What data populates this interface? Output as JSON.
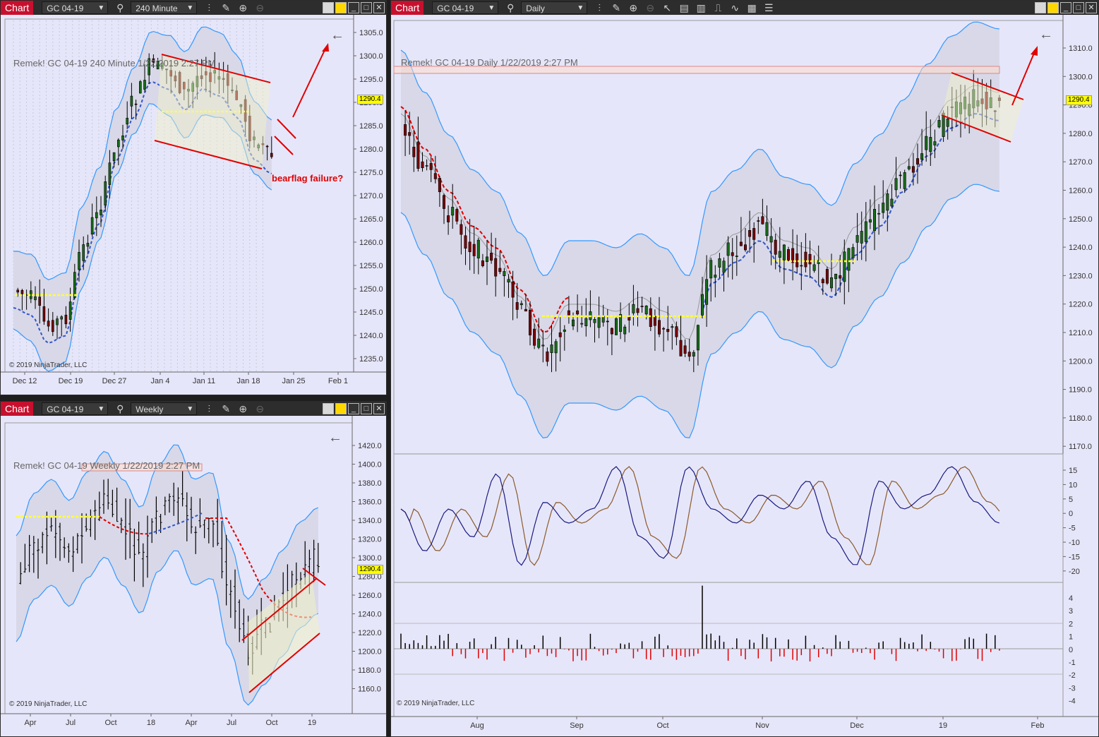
{
  "panels": [
    {
      "id": "p240",
      "tab": "Chart",
      "instrument": "GC 04-19",
      "interval": "240 Minute",
      "title": "Remek!  GC 04-19  240 Minute  1/22/2019 2:27 PM",
      "copyright": "© 2019 NinjaTrader, LLC",
      "price_tag": "1290.4",
      "y_labels": [
        "1305.0",
        "1300.0",
        "1295.0",
        "1290.0",
        "1285.0",
        "1280.0",
        "1275.0",
        "1270.0",
        "1265.0",
        "1260.0",
        "1255.0",
        "1250.0",
        "1245.0",
        "1240.0",
        "1235.0"
      ],
      "x_labels": [
        "Dec 12",
        "Dec 19",
        "Dec 27",
        "Jan 4",
        "Jan 11",
        "Jan 18",
        "Jan 25",
        "Feb 1"
      ],
      "annotation": "bearflag failure?"
    },
    {
      "id": "pW",
      "tab": "Chart",
      "instrument": "GC 04-19",
      "interval": "Weekly",
      "title": "Remek!  GC 04-19  Weekly  1/22/2019 2:27 PM",
      "copyright": "© 2019 NinjaTrader, LLC",
      "price_tag": "1290.4",
      "y_labels": [
        "1420.0",
        "1400.0",
        "1380.0",
        "1360.0",
        "1340.0",
        "1320.0",
        "1300.0",
        "1280.0",
        "1260.0",
        "1240.0",
        "1220.0",
        "1200.0",
        "1180.0",
        "1160.0"
      ],
      "x_labels": [
        "Apr",
        "Jul",
        "Oct",
        "18",
        "Apr",
        "Jul",
        "Oct",
        "19"
      ]
    },
    {
      "id": "pD",
      "tab": "Chart",
      "instrument": "GC 04-19",
      "interval": "Daily",
      "title": "Remek!  GC 04-19  Daily  1/22/2019 2:27 PM",
      "copyright": "© 2019 NinjaTrader, LLC",
      "price_tag": "1290.4",
      "y_labels": [
        "1310.0",
        "1300.0",
        "1290.0",
        "1280.0",
        "1270.0",
        "1260.0",
        "1250.0",
        "1240.0",
        "1230.0",
        "1220.0",
        "1210.0",
        "1200.0",
        "1190.0",
        "1180.0",
        "1170.0"
      ],
      "osc_labels": [
        "15",
        "10",
        "5",
        "0",
        "-5",
        "-10",
        "-15",
        "-20"
      ],
      "vol_labels": [
        "4",
        "3",
        "2",
        "1",
        "0",
        "-1",
        "-2",
        "-3",
        "-4"
      ],
      "x_labels": [
        "Aug",
        "Sep",
        "Oct",
        "Nov",
        "Dec",
        "19",
        "Feb"
      ]
    }
  ],
  "colors": {
    "bg": "#e6e6fa",
    "up": "#1a6b1a",
    "down": "#7a0000",
    "band": "#3399ff",
    "red_ma": "#e00000",
    "blue_ma": "#3355cc",
    "yellow_line": "#ffff33",
    "annotation": "#e00000"
  }
}
